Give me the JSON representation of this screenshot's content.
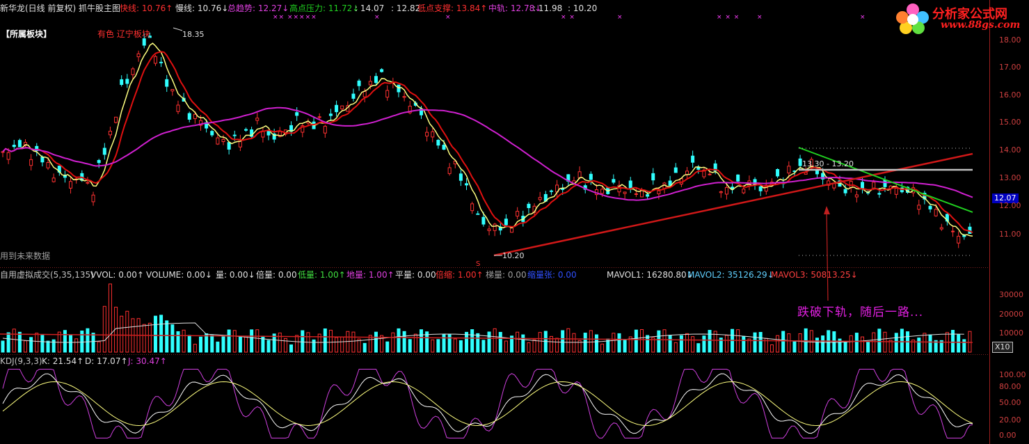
{
  "header": {
    "title": "新华龙(日线 前复权) 抓牛股主图",
    "items": [
      {
        "label": "快线:",
        "value": "10.76",
        "arrow": "↑",
        "color": "#ff3030"
      },
      {
        "label": "慢线:",
        "value": "10.76",
        "arrow": "↓",
        "color": "#e0e0e0"
      },
      {
        "label": "总趋势:",
        "value": "12.27",
        "arrow": "↓",
        "color": "#e040e0"
      },
      {
        "label": "高点压力:",
        "value": "11.72",
        "arrow": "↓",
        "color": "#20d020"
      },
      {
        "label": ":",
        "value": "14.07",
        "arrow": "",
        "color": "#e0e0e0"
      },
      {
        "label": ":",
        "value": "12.82",
        "arrow": "",
        "color": "#e0e0e0"
      },
      {
        "label": "低点支撑:",
        "value": "13.84",
        "arrow": "↑",
        "color": "#ff3030"
      },
      {
        "label": "中轨:",
        "value": "12.78",
        "arrow": "↓",
        "color": "#e040e0"
      },
      {
        "label": ":",
        "value": "11.98",
        "arrow": "",
        "color": "#e0e0e0"
      },
      {
        "label": ":",
        "value": "10.20",
        "arrow": "",
        "color": "#e0e0e0"
      }
    ]
  },
  "main_panel": {
    "block_label": "【所属板块】",
    "sector_text": "有色 辽宁板块",
    "high_label": "18.35",
    "low_label": "10.20",
    "future_data_note": "用到未来数据",
    "range_label": "13.30 - 13.20",
    "s_mark": "S",
    "current_price_box": "12.07",
    "y_axis": [
      "18.00",
      "17.00",
      "16.00",
      "15.00",
      "14.00",
      "13.00",
      "12.00",
      "11.00"
    ]
  },
  "volume_panel": {
    "items": [
      {
        "text": "自用虚拟成交(5,35,135)",
        "color": "#c0c0c0"
      },
      {
        "text": "VVOL: 0.00↑",
        "color": "#e0e0e0"
      },
      {
        "text": "VOLUME: 0.00↓",
        "color": "#e0e0e0"
      },
      {
        "text": "量: 0.00↓",
        "color": "#e0e0e0"
      },
      {
        "text": "倍量: 0.00",
        "color": "#e0e0e0"
      },
      {
        "text": "低量: 1.00↑",
        "color": "#40e040"
      },
      {
        "text": "地量: 1.00↑",
        "color": "#e040e0"
      },
      {
        "text": "平量: 0.00",
        "color": "#e0e0e0"
      },
      {
        "text": "倍缩: 1.00↑",
        "color": "#ff3030"
      },
      {
        "text": "梯量: 0.00",
        "color": "#a0a0a0"
      },
      {
        "text": "缩量张: 0.00",
        "color": "#3050ff"
      },
      {
        "text": "MAVOL1: 16280.80↓",
        "color": "#e0e0e0"
      },
      {
        "text": "MAVOL2: 35126.29↓",
        "color": "#60d0ff"
      },
      {
        "text": "MAVOL3: 50813.25↓",
        "color": "#ff4040"
      }
    ],
    "annotation": "跌破下轨，随后一路...",
    "bei_label": "倍",
    "y_axis": [
      "30000",
      "20000",
      "10000"
    ],
    "unit_box": "X10"
  },
  "kdj_panel": {
    "items": [
      {
        "text": "KDJ(9,3,3)",
        "color": "#c0c0c0"
      },
      {
        "text": "K: 21.54↑",
        "color": "#e0e0e0"
      },
      {
        "text": "D: 17.07↑",
        "color": "#e0e0e0"
      },
      {
        "text": "J: 30.47↑",
        "color": "#e040e0"
      }
    ],
    "y_axis": [
      "100.00",
      "80.00",
      "50.00",
      "20.00",
      "0.00"
    ]
  },
  "logo": {
    "name": "分析家公式网",
    "url": "www.88gs.com"
  },
  "colors": {
    "up": "#ff3030",
    "down": "#30ffff",
    "ma_fast": "#ffff80",
    "ma_slow": "#e01010",
    "ma_long": "#d020d0",
    "trend_green": "#20d020",
    "support_gray": "#c0c0c0"
  }
}
